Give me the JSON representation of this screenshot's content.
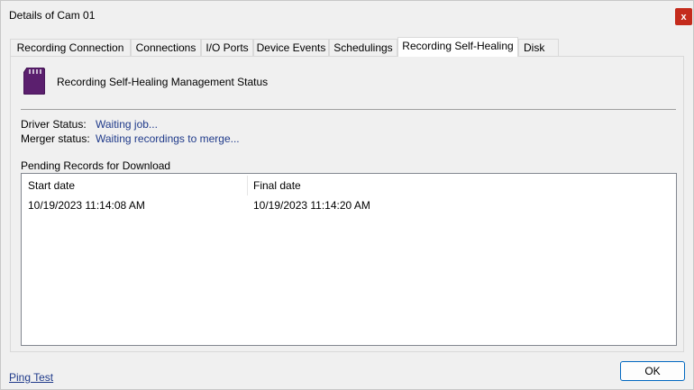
{
  "window": {
    "title": "Details of Cam 01",
    "close_label": "x"
  },
  "tabs": [
    {
      "label": "Recording Connection"
    },
    {
      "label": "Connections"
    },
    {
      "label": "I/O Ports"
    },
    {
      "label": "Device Events"
    },
    {
      "label": "Schedulings"
    },
    {
      "label": "Recording Self-Healing",
      "active": true
    },
    {
      "label": "Disk"
    }
  ],
  "panel": {
    "icon": "sd-card-icon",
    "heading": "Recording Self-Healing Management Status",
    "driver_status_label": "Driver Status:",
    "driver_status_value": "Waiting job...",
    "merger_status_label": "Merger status:",
    "merger_status_value": "Waiting recordings to merge...",
    "pending_label": "Pending Records for Download",
    "columns": [
      "Start date",
      "Final date"
    ],
    "rows": [
      [
        "10/19/2023 11:14:08 AM",
        "10/19/2023 11:14:20 AM"
      ]
    ]
  },
  "footer": {
    "ping_test_label": "Ping Test",
    "ok_label": "OK"
  },
  "colors": {
    "link": "#1f3a8a",
    "close_button": "#c42b1c",
    "sd_card": "#5b1f6e",
    "ok_border": "#0067c0"
  }
}
